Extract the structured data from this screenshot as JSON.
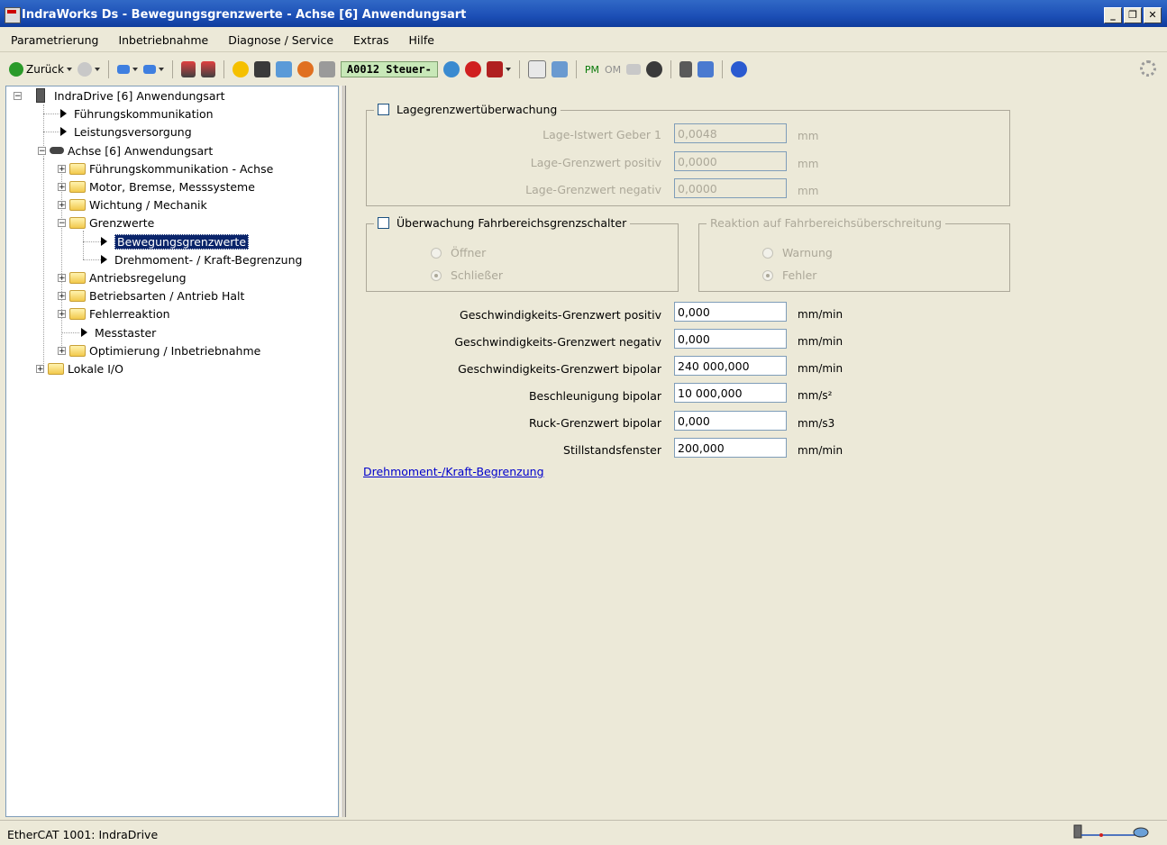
{
  "window": {
    "title": "IndraWorks Ds - Bewegungsgrenzwerte - Achse [6] Anwendungsart"
  },
  "menu": [
    "Parametrierung",
    "Inbetriebnahme",
    "Diagnose / Service",
    "Extras",
    "Hilfe"
  ],
  "toolbar": {
    "back_label": "Zurück",
    "status_code": "A0012 Steuer-",
    "pm_label": "PM",
    "om_label": "OM"
  },
  "tree": [
    {
      "label": "IndraDrive [6] Anwendungsart",
      "level": 0,
      "type": "drive",
      "expander": "minus"
    },
    {
      "label": "Führungskommunikation",
      "level": 1,
      "type": "arrow"
    },
    {
      "label": "Leistungsversorgung",
      "level": 1,
      "type": "arrow"
    },
    {
      "label": "Achse [6] Anwendungsart",
      "level": 1,
      "type": "axis",
      "expander": "minus"
    },
    {
      "label": "Führungskommunikation - Achse",
      "level": 2,
      "type": "folder",
      "expander": "plus"
    },
    {
      "label": "Motor, Bremse, Messsysteme",
      "level": 2,
      "type": "folder",
      "expander": "plus"
    },
    {
      "label": "Wichtung / Mechanik",
      "level": 2,
      "type": "folder",
      "expander": "plus"
    },
    {
      "label": "Grenzwerte",
      "level": 2,
      "type": "folder",
      "expander": "minus"
    },
    {
      "label": "Bewegungsgrenzwerte",
      "level": 3,
      "type": "arrow",
      "selected": true
    },
    {
      "label": "Drehmoment- / Kraft-Begrenzung",
      "level": 3,
      "type": "arrow"
    },
    {
      "label": "Antriebsregelung",
      "level": 2,
      "type": "folder",
      "expander": "plus"
    },
    {
      "label": "Betriebsarten / Antrieb Halt",
      "level": 2,
      "type": "folder",
      "expander": "plus"
    },
    {
      "label": "Fehlerreaktion",
      "level": 2,
      "type": "folder",
      "expander": "plus"
    },
    {
      "label": "Messtaster",
      "level": 2,
      "type": "arrow"
    },
    {
      "label": "Optimierung / Inbetriebnahme",
      "level": 2,
      "type": "folder",
      "expander": "plus"
    },
    {
      "label": "Lokale I/O",
      "level": 1,
      "type": "folder",
      "expander": "plus"
    }
  ],
  "position_group": {
    "title": "Lagegrenzwertüberwachung",
    "checked": false,
    "fields": [
      {
        "label": "Lage-Istwert Geber 1",
        "value": "0,0048",
        "unit": "mm"
      },
      {
        "label": "Lage-Grenzwert positiv",
        "value": "0,0000",
        "unit": "mm"
      },
      {
        "label": "Lage-Grenzwert negativ",
        "value": "0,0000",
        "unit": "mm"
      }
    ]
  },
  "limit_switch_group": {
    "title": "Überwachung Fahrbereichsgrenzschalter",
    "checked": false,
    "options": [
      {
        "label": "Öffner",
        "checked": false
      },
      {
        "label": "Schließer",
        "checked": true
      }
    ]
  },
  "reaction_group": {
    "title": "Reaktion auf Fahrbereichsüberschreitung",
    "options": [
      {
        "label": "Warnung",
        "checked": false
      },
      {
        "label": "Fehler",
        "checked": true
      }
    ]
  },
  "velocity_fields": [
    {
      "label": "Geschwindigkeits-Grenzwert positiv",
      "value": "0,000",
      "unit": "mm/min"
    },
    {
      "label": "Geschwindigkeits-Grenzwert negativ",
      "value": "0,000",
      "unit": "mm/min"
    },
    {
      "label": "Geschwindigkeits-Grenzwert bipolar",
      "value": "240 000,000",
      "unit": "mm/min"
    },
    {
      "label": "Beschleunigung bipolar",
      "value": "10 000,000",
      "unit": "mm/s²"
    },
    {
      "label": "Ruck-Grenzwert bipolar",
      "value": "0,000",
      "unit": "mm/s3"
    },
    {
      "label": "Stillstandsfenster",
      "value": "200,000",
      "unit": "mm/min"
    }
  ],
  "link": {
    "label": "Drehmoment-/Kraft-Begrenzung"
  },
  "statusbar": {
    "text": "EtherCAT 1001:  IndraDrive"
  }
}
